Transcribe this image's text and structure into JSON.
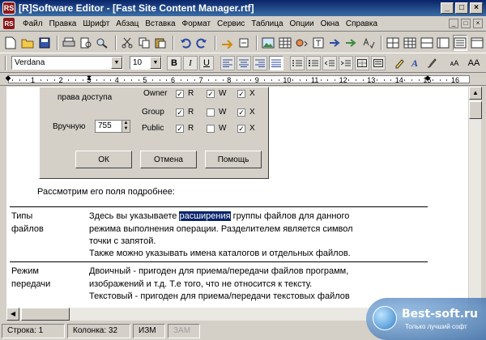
{
  "window": {
    "title": "[R]Software Editor - [Fast Site Content Manager.rtf]",
    "icon_text": "RS",
    "minimize": "_",
    "maximize": "□",
    "close": "×"
  },
  "menu": [
    "Файл",
    "Правка",
    "Шрифт",
    "Абзац",
    "Вставка",
    "Формат",
    "Сервис",
    "Таблица",
    "Опции",
    "Окна",
    "Справка"
  ],
  "format_bar": {
    "font": "Verdana",
    "size": "10",
    "bold": "B",
    "italic": "I",
    "underline": "U",
    "font_small": "ᴀA",
    "font_big": "AA"
  },
  "ruler": {
    "numbers": [
      "1",
      "2",
      "3",
      "4",
      "5",
      "6",
      "7",
      "8",
      "9",
      "10",
      "11",
      "12",
      "13",
      "14",
      "15",
      "16"
    ]
  },
  "dialog": {
    "access_label": "права доступа",
    "rows": [
      {
        "name": "Owner",
        "r": "R",
        "w": "W",
        "x": "X",
        "checked_r": "✓",
        "checked_w": "✓",
        "checked_x": "✓"
      },
      {
        "name": "Group",
        "r": "R",
        "w": "W",
        "x": "X",
        "checked_r": "✓",
        "checked_w": "",
        "checked_x": "✓"
      },
      {
        "name": "Public",
        "r": "R",
        "w": "W",
        "x": "X",
        "checked_r": "✓",
        "checked_w": "",
        "checked_x": "✓"
      }
    ],
    "manual_label": "Вручную",
    "manual_value": "755",
    "ok": "ОК",
    "cancel": "Отмена",
    "help": "Помощь"
  },
  "doc": {
    "intro": "Рассмотрим его поля подробнее:",
    "row1": {
      "term1": "Типы",
      "term2": "файлов",
      "l1_pre": "Здесь вы указываете ",
      "l1_hl": "расширения",
      "l1_post": " группы файлов для данного",
      "l2": "режима выполнения операции. Разделителем является символ",
      "l3": "точки с запятой.",
      "l4": "Также можно указывать имена каталогов и отдельных файлов."
    },
    "row2": {
      "term1": "Режим",
      "term2": "передачи",
      "l1": "Двоичный - пригоден для приема/передачи файлов программ,",
      "l2": "изображений и т.д. Т.е того, что не относится к тексту.",
      "l3": "Текстовый - пригоден для приема/передачи текстовых файлов"
    }
  },
  "status": {
    "row": "Строка: 1",
    "col": "Колонка: 32",
    "mode": "ИЗМ",
    "zam": "ЗАМ"
  },
  "watermark": {
    "main": "Best-soft.ru",
    "sub": "Только лучший софт"
  }
}
